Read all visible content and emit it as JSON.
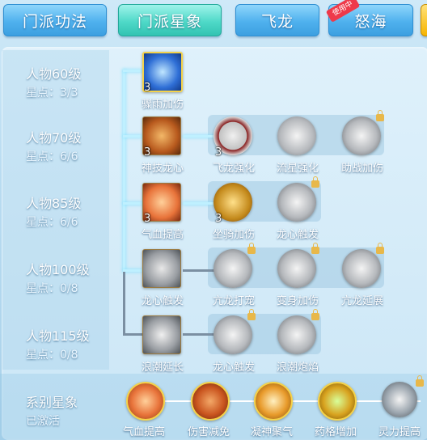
{
  "tabs": [
    {
      "label": "门派功法"
    },
    {
      "label": "门派星象"
    },
    {
      "label": "飞龙"
    },
    {
      "label": "怒海",
      "badge": "使用中"
    }
  ],
  "levels": [
    {
      "name": "人物60级",
      "points": "星点：3/3"
    },
    {
      "name": "人物70级",
      "points": "星点：6/6"
    },
    {
      "name": "人物85级",
      "points": "星点：6/6"
    },
    {
      "name": "人物100级",
      "points": "星点：0/8"
    },
    {
      "name": "人物115级",
      "points": "星点：0/8"
    }
  ],
  "rows": [
    {
      "skills": [
        {
          "label": "骤雨加伤",
          "count": "3",
          "icon": "rain-vortex-icon",
          "color": "#2f6fd6"
        }
      ]
    },
    {
      "skills": [
        {
          "label": "神技龙心",
          "count": "3",
          "icon": "dragon-heart-icon",
          "color": "#b85a1e"
        },
        {
          "label": "飞龙强化",
          "count": "3",
          "icon": "flying-dragon-icon",
          "color": "#8a2020"
        },
        {
          "label": "流星强化",
          "icon": "meteor-icon",
          "color": "#8c9096"
        },
        {
          "label": "助战加伤",
          "icon": "assist-damage-icon",
          "color": "#8c9096",
          "locked": true
        }
      ]
    },
    {
      "skills": [
        {
          "label": "气血提高",
          "count": "3",
          "icon": "heart-icon",
          "color": "#e8733a"
        },
        {
          "label": "坐骑加伤",
          "count": "3",
          "icon": "mount-icon",
          "color": "#c48a1c"
        },
        {
          "label": "龙心触发",
          "icon": "dragon-trigger-icon",
          "color": "#8c9096",
          "locked": true
        }
      ]
    },
    {
      "skills": [
        {
          "label": "龙心触发",
          "icon": "dragon-trigger-icon",
          "color": "#8c9096"
        },
        {
          "label": "亢龙打宠",
          "icon": "dragon-pet-icon",
          "color": "#8c9096",
          "locked": true
        },
        {
          "label": "变身加伤",
          "icon": "transform-icon",
          "color": "#8c9096",
          "locked": true
        },
        {
          "label": "亢龙延展",
          "icon": "dragon-extend-icon",
          "color": "#8c9096",
          "locked": true
        }
      ]
    },
    {
      "skills": [
        {
          "label": "浪潮延长",
          "icon": "wave-icon",
          "color": "#8c9096"
        },
        {
          "label": "龙心触发",
          "icon": "wave-icon",
          "color": "#8c9096",
          "locked": true
        },
        {
          "label": "浪潮炮焰",
          "icon": "wave-icon",
          "color": "#8c9096",
          "locked": true
        }
      ]
    }
  ],
  "series": {
    "title": "系别星象",
    "status": "已激活",
    "items": [
      {
        "label": "气血提高",
        "icon": "heart-icon",
        "color": "#e8733a"
      },
      {
        "label": "伤害减免",
        "icon": "damage-reduce-icon",
        "color": "#c9541e"
      },
      {
        "label": "凝神聚气",
        "icon": "focus-icon",
        "color": "#e89a2a"
      },
      {
        "label": "药格增加",
        "icon": "medicine-icon",
        "color": "#d8a21e"
      },
      {
        "label": "灵力提高",
        "icon": "spirit-icon",
        "color": "#9aa4ad",
        "locked": true
      }
    ]
  }
}
